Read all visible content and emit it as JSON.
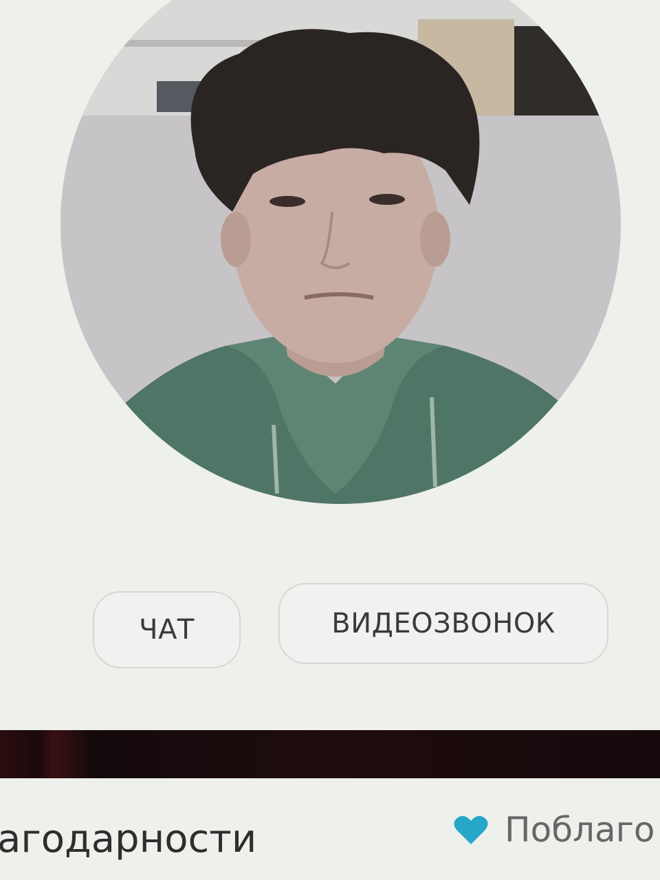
{
  "profile": {
    "avatar_alt": "profile photo"
  },
  "actions": {
    "chat_label": "ЧАТ",
    "video_call_label": "ВИДЕОЗВОНОК"
  },
  "footer": {
    "left_text": "агодарности",
    "right_text": "Поблаго",
    "heart_color": "#27a7c9"
  }
}
